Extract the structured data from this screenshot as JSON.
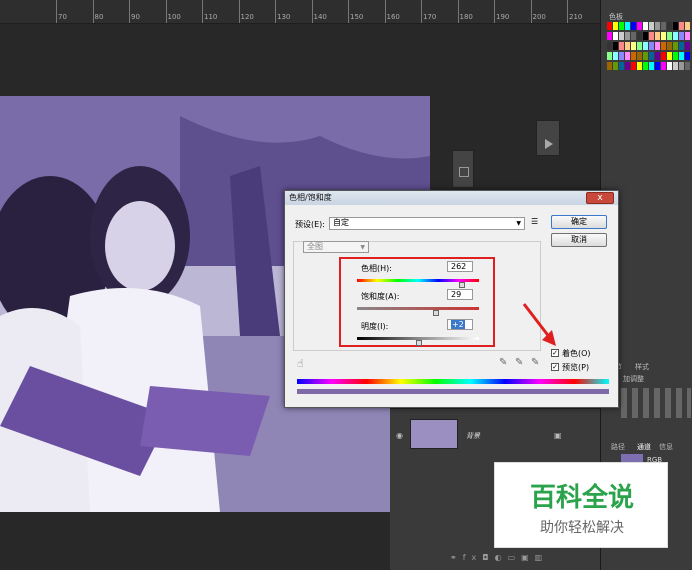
{
  "ruler": {
    "labels": [
      "70",
      "80",
      "90",
      "100",
      "110",
      "120",
      "130",
      "140",
      "150",
      "160",
      "170",
      "180",
      "190",
      "200",
      "210"
    ]
  },
  "swatches_panel": {
    "tab": "色板"
  },
  "dialog": {
    "title": "色相/饱和度",
    "preset_label": "预设(E):",
    "preset_value": "自定",
    "channel_value": "全图",
    "hue_label": "色相(H):",
    "hue_value": "262",
    "saturation_label": "饱和度(A):",
    "saturation_value": "29",
    "lightness_label": "明度(I):",
    "lightness_value": "+2",
    "ok_label": "确定",
    "cancel_label": "取消",
    "colorize_label": "着色(O)",
    "preview_label": "预览(P)",
    "close_glyph": "x"
  },
  "adjustments_panel": {
    "tab1": "节",
    "tab2": "样式",
    "label": "加调整"
  },
  "channels_panel": {
    "tabs": [
      "路径",
      "通道",
      "信息"
    ],
    "channel": "RGB"
  },
  "layers": {
    "layer_name": "背景"
  },
  "watermark": {
    "title": "百科全说",
    "subtitle": "助你轻松解决"
  },
  "colors": {
    "accent_red": "#e02020",
    "photo_tint": "#6a5a9a"
  }
}
